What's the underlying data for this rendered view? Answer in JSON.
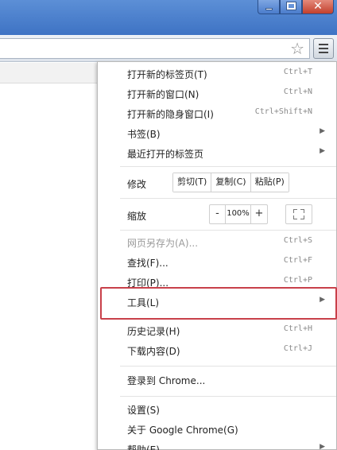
{
  "menu": {
    "items": [
      {
        "label": "打开新的标签页(T)",
        "shortcut": "Ctrl+T"
      },
      {
        "label": "打开新的窗口(N)",
        "shortcut": "Ctrl+N"
      },
      {
        "label": "打开新的隐身窗口(I)",
        "shortcut": "Ctrl+Shift+N"
      },
      {
        "label": "书签(B)"
      },
      {
        "label": "最近打开的标签页"
      }
    ],
    "edit": {
      "label": "修改",
      "cut": "剪切(T)",
      "copy": "复制(C)",
      "paste": "粘贴(P)"
    },
    "zoom": {
      "label": "缩放",
      "minus": "-",
      "value": "100%",
      "plus": "+"
    },
    "items2": [
      {
        "label": "网页另存为(A)...",
        "shortcut": "Ctrl+S"
      },
      {
        "label": "查找(F)...",
        "shortcut": "Ctrl+F"
      },
      {
        "label": "打印(P)...",
        "shortcut": "Ctrl+P"
      },
      {
        "label": "工具(L)"
      }
    ],
    "items3": [
      {
        "label": "历史记录(H)",
        "shortcut": "Ctrl+H"
      },
      {
        "label": "下载内容(D)",
        "shortcut": "Ctrl+J"
      }
    ],
    "signin": "登录到 Chrome...",
    "items4": [
      {
        "label": "设置(S)"
      },
      {
        "label": "关于 Google Chrome(G)"
      },
      {
        "label": "帮助(E)"
      }
    ]
  },
  "colors": {
    "highlight": "#c8404a",
    "titlebar": "#4a7ccc"
  }
}
